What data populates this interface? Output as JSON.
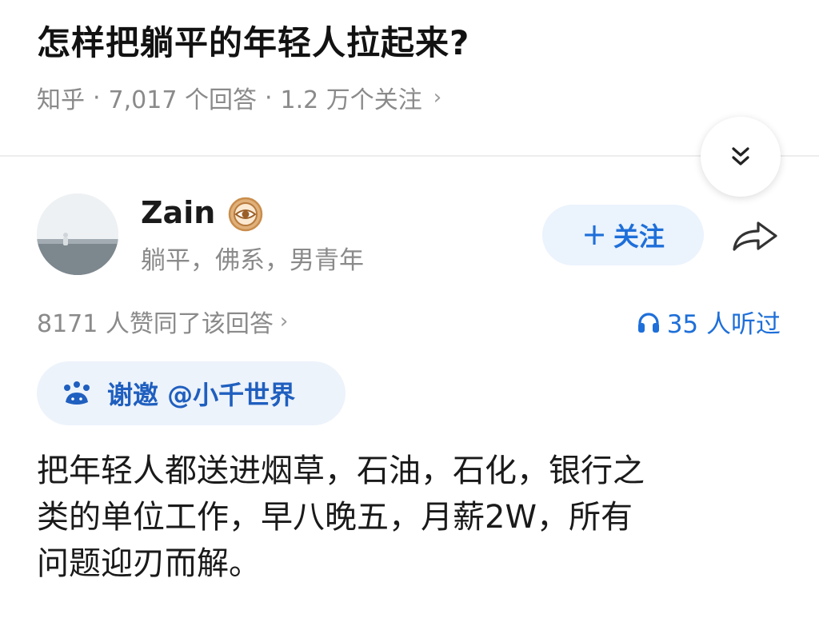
{
  "question": {
    "title": "怎样把躺平的年轻人拉起来?",
    "site": "知乎",
    "sep": "·",
    "answers": "7,017 个回答",
    "follows": "1.2 万个关注",
    "chevron": "›"
  },
  "author": {
    "name": "Zain",
    "bio": "躺平，佛系，男青年",
    "badge_icon": "eye-badge-icon"
  },
  "actions": {
    "follow_plus": "+",
    "follow_label": "关注",
    "share_icon": "share-arrow-icon",
    "collapse_icon": "double-chevron-down-icon"
  },
  "stats": {
    "likes": "8171 人赞同了该回答",
    "listened": "35 人听过"
  },
  "invite": {
    "label": "谢邀 @小千世界"
  },
  "answer": {
    "lines": [
      "把年轻人都送进烟草，石油，石化，银行之",
      "类的单位工作，早八晚五，月薪2W，所有",
      "问题迎刃而解。"
    ]
  },
  "colors": {
    "accent": "#1e6fd9",
    "follow_bg": "#ebf3fd",
    "invite_bg": "#edf3fb",
    "muted": "#8a8a8a"
  }
}
